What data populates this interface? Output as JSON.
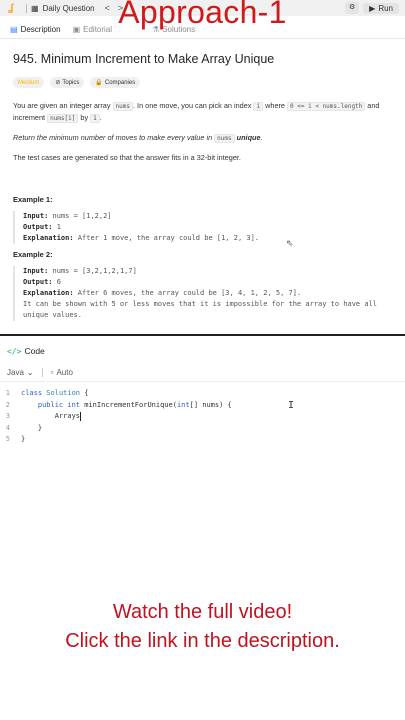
{
  "overlay_title": "Approach-1",
  "topbar": {
    "daily_question": "Daily Question",
    "run": "Run"
  },
  "tabs": [
    {
      "label": "Description",
      "active": true
    },
    {
      "label": "Editorial",
      "active": false
    },
    {
      "label": "Solutions",
      "active": false
    }
  ],
  "problem": {
    "title": "945. Minimum Increment to Make Array Unique",
    "difficulty": "Medium",
    "topics": "Topics",
    "companies": "Companies",
    "desc1_a": "You are given an integer array ",
    "desc1_code1": "nums",
    "desc1_b": ". In one move, you can pick an index ",
    "desc1_code2": "i",
    "desc1_c": " where ",
    "desc1_code3": "0 <= i < nums.length",
    "desc1_d": " and increment ",
    "desc1_code4": "nums[i]",
    "desc1_e": " by ",
    "desc1_code5": "1",
    "desc1_f": ".",
    "desc2_a": "Return the minimum number of moves to make every value in ",
    "desc2_code": "nums",
    "desc2_b": "unique",
    "desc2_c": ".",
    "desc3": "The test cases are generated so that the answer fits in a 32-bit integer.",
    "examples": [
      {
        "title": "Example 1:",
        "input": "nums = [1,2,2]",
        "output": "1",
        "explanation": "After 1 move, the array could be [1, 2, 3].",
        "extra": ""
      },
      {
        "title": "Example 2:",
        "input": "nums = [3,2,1,2,1,7]",
        "output": "6",
        "explanation": "After 6 moves, the array could be [3, 4, 1, 2, 5, 7].",
        "extra": "It can be shown with 5 or less moves that it is impossible for the array to have all unique values."
      }
    ],
    "labels": {
      "input": "Input:",
      "output": "Output:",
      "explanation": "Explanation:"
    }
  },
  "code_panel": {
    "title": "Code",
    "language": "Java",
    "auto": "Auto",
    "lines": [
      {
        "n": "1",
        "text": "class Solution {"
      },
      {
        "n": "2",
        "text": "    public int minIncrementForUnique(int[] nums) {"
      },
      {
        "n": "3",
        "text": "        Arrays"
      },
      {
        "n": "4",
        "text": "    }"
      },
      {
        "n": "5",
        "text": "}"
      }
    ]
  },
  "cta": {
    "line1": "Watch the full video!",
    "line2": "Click the link in the description."
  },
  "colors": {
    "accent_red": "#d01a1a",
    "medium": "#ffb800",
    "code_icon": "#2db55d"
  }
}
